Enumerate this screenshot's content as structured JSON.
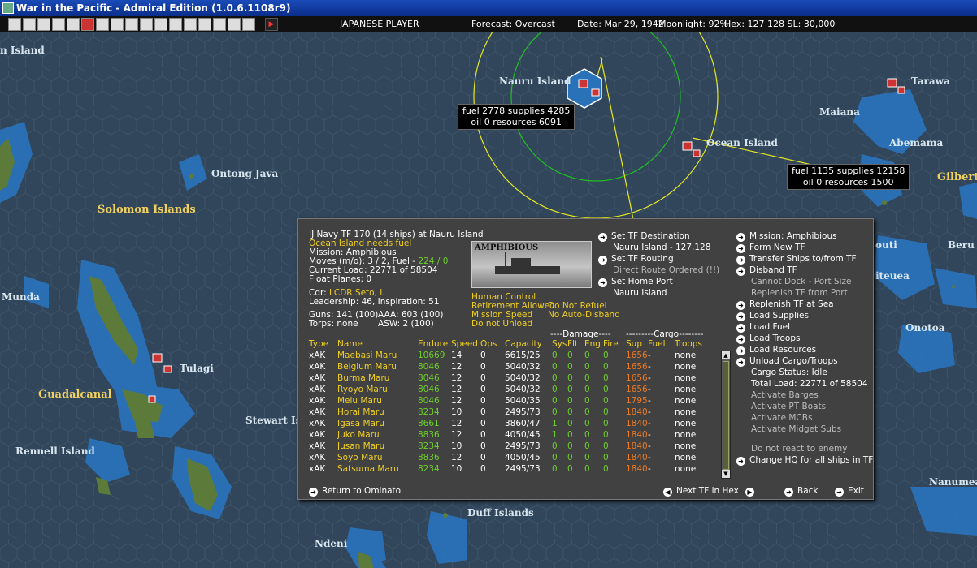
{
  "window": {
    "title": "War in the Pacific - Admiral Edition (1.0.6.1108r9)"
  },
  "toolbar": {
    "player": "JAPANESE PLAYER",
    "forecast": "Forecast: Overcast",
    "date": "Date: Mar 29, 1942",
    "moonlight": "Moonlight: 92%",
    "hex": "Hex: 127 128  SL: 30,000",
    "icons": [
      "map-icon",
      "list-icon",
      "base-icon",
      "group-icon",
      "info-icon",
      "japan-flag-icon",
      "plane-icon",
      "fighter-icon",
      "flag-icon",
      "ship-icon",
      "sub-icon",
      "land-icon",
      "fleet-icon",
      "tf-icon",
      "air-icon",
      "off-icon",
      "cloud-icon",
      "end-turn-icon"
    ]
  },
  "map": {
    "labels": {
      "island": "n Island",
      "nauru": "Nauru Island",
      "ocean": "Ocean Island",
      "tarawa": "Tarawa",
      "maiana": "Maiana",
      "abemama": "Abemama",
      "gilbert": "Gilbert",
      "ontong": "Ontong Java",
      "solomon": "Solomon Islands",
      "munda": "Munda",
      "tulagi": "Tulagi",
      "guadalcanal": "Guadalcanal",
      "stewart": "Stewart Is",
      "rennell": "Rennell Island",
      "duff": "Duff Islands",
      "ndeni": "Ndeni",
      "beru": "Beru",
      "outi": "outi",
      "iteuea": "iteuea",
      "onotoa": "Onotoa",
      "nanumea": "Nanumea"
    },
    "nauru_box": {
      "line1": "fuel 2778  supplies 4285",
      "line2": "oil 0  resources 6091"
    },
    "ocean_box": {
      "line1": "fuel 1135  supplies 12158",
      "line2": "oil 0  resources 1500"
    }
  },
  "tf": {
    "header": "IJ Navy TF 170 (14 ships) at Nauru Island",
    "warning": "Ocean Island needs fuel",
    "mission": "Mission: Amphibious",
    "moves": "Moves (m/o): 3 / 2, Fuel - ",
    "moves_fuel": "224 / 0",
    "load": "Current Load: 22771 of 58504",
    "float": "Float Planes: 0",
    "cdr_label": "Cdr:",
    "cdr": "LCDR Seto, I.",
    "leadership": "Leadership: 46, Inspiration: 51",
    "guns": "Guns: 141 (100)",
    "aaa": "AAA: 603 (100)",
    "torps": "Torps: none",
    "asw": "ASW: 2 (100)",
    "photo_label": "AMPHIBIOUS",
    "control": "Human Control",
    "retire": "Retirement Allowed",
    "refuel": "Do Not Refuel",
    "speed": "Mission Speed",
    "disband": "No Auto-Disband",
    "unload": "Do not Unload",
    "dest_btn": "Set TF Destination",
    "dest_val": "Nauru Island - 127,128",
    "routing_btn": "Set TF Routing",
    "routing_val": "Direct Route Ordered (!!)",
    "home_btn": "Set Home Port",
    "home_val": "Nauru Island"
  },
  "actions": {
    "mission": "Mission: Amphibious",
    "form": "Form New TF",
    "transfer": "Transfer Ships to/from TF",
    "disband": "Disband TF",
    "nodock": "Cannot Dock - Port Size",
    "replport": "Replenish TF from Port",
    "replsea": "Replenish TF at Sea",
    "loadsup": "Load Supplies",
    "loadfuel": "Load Fuel",
    "loadtroops": "Load Troops",
    "loadres": "Load Resources",
    "unload": "Unload Cargo/Troops",
    "cargostatus": "Cargo Status: Idle",
    "totalload": "Total Load: 22771 of 58504",
    "barges": "Activate Barges",
    "pt": "Activate PT Boats",
    "mcb": "Activate MCBs",
    "midget": "Activate Midget Subs",
    "noreact": "Do not react to enemy",
    "changehq": "Change HQ for all ships in TF"
  },
  "table": {
    "group_damage": "----Damage----",
    "group_cargo": "---------Cargo--------",
    "headers": [
      "Type",
      "Name",
      "Endure",
      "Speed",
      "Ops",
      "Capacity",
      "Sys",
      "Flt",
      "Eng",
      "Fire",
      "Sup",
      "Fuel",
      "Troops"
    ],
    "rows": [
      [
        "xAK",
        "Maebasi Maru",
        "10669",
        "14",
        "0",
        "6615/25",
        "0",
        "0",
        "0",
        "0",
        "1656",
        "-",
        "none"
      ],
      [
        "xAK",
        "Belgium Maru",
        "8046",
        "12",
        "0",
        "5040/32",
        "0",
        "0",
        "0",
        "0",
        "1656",
        "-",
        "none"
      ],
      [
        "xAK",
        "Burma Maru",
        "8046",
        "12",
        "0",
        "5040/32",
        "0",
        "0",
        "0",
        "0",
        "1656",
        "-",
        "none"
      ],
      [
        "xAK",
        "Ryoyo Maru",
        "8046",
        "12",
        "0",
        "5040/32",
        "0",
        "0",
        "0",
        "0",
        "1656",
        "-",
        "none"
      ],
      [
        "xAK",
        "Meiu Maru",
        "8046",
        "12",
        "0",
        "5040/35",
        "0",
        "0",
        "0",
        "0",
        "1795",
        "-",
        "none"
      ],
      [
        "xAK",
        "Horai Maru",
        "8234",
        "10",
        "0",
        "2495/73",
        "0",
        "0",
        "0",
        "0",
        "1840",
        "-",
        "none"
      ],
      [
        "xAK",
        "Igasa Maru",
        "8661",
        "12",
        "0",
        "3860/47",
        "1",
        "0",
        "0",
        "0",
        "1840",
        "-",
        "none"
      ],
      [
        "xAK",
        "Juko Maru",
        "8836",
        "12",
        "0",
        "4050/45",
        "1",
        "0",
        "0",
        "0",
        "1840",
        "-",
        "none"
      ],
      [
        "xAK",
        "Jusan Maru",
        "8234",
        "10",
        "0",
        "2495/73",
        "0",
        "0",
        "0",
        "0",
        "1840",
        "-",
        "none"
      ],
      [
        "xAK",
        "Soyo Maru",
        "8836",
        "12",
        "0",
        "4050/45",
        "0",
        "0",
        "0",
        "0",
        "1840",
        "-",
        "none"
      ],
      [
        "xAK",
        "Satsuma Maru",
        "8234",
        "10",
        "0",
        "2495/73",
        "0",
        "0",
        "0",
        "0",
        "1840",
        "-",
        "none"
      ]
    ]
  },
  "footer": {
    "return": "Return to Ominato",
    "next": "Next TF in Hex",
    "back": "Back",
    "exit": "Exit"
  },
  "colors": {
    "highlight": "#f0d020",
    "good": "#6cd02a",
    "cargo": "#f07a20",
    "panel": "#414141"
  }
}
